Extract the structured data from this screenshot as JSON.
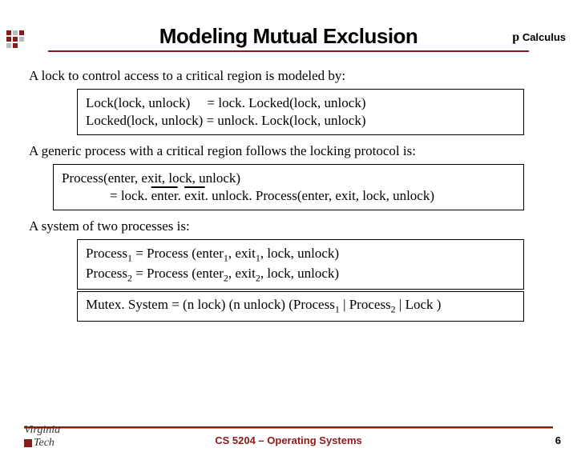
{
  "header": {
    "label": "Calculus",
    "pi": "p"
  },
  "title": "Modeling Mutual Exclusion",
  "p1": "A lock to control access to a critical region is modeled by:",
  "box1": {
    "l1": "Lock(lock, unlock)     = lock. Locked(lock, unlock)",
    "l2": "Locked(lock, unlock) = unlock. Lock(lock, unlock)"
  },
  "p2": "A generic process with a critical region follows the locking protocol is:",
  "box2": {
    "l1": "Process(enter, exit, lock, unlock)",
    "l2_pre": "= lock. ",
    "l2_enter": "enter",
    "l2_mid1": ". ",
    "l2_exit": "exit",
    "l2_mid2": ". unlock. Process(enter, exit, lock, unlock)"
  },
  "p3": "A system of two processes is:",
  "box3": {
    "l1a": "Process",
    "l1b": " = Process (enter",
    "l1c": ", exit",
    "l1d": ", lock, unlock)",
    "l2a": "Process",
    "l2b": " = Process (enter",
    "l2c": ", exit",
    "l2d": ", lock, unlock)"
  },
  "box4": {
    "pre": "Mutex. System = (",
    "nu": "n",
    "mid1": " lock) (",
    "mid2": " unlock) (Process",
    "mid3": " | Process",
    "mid4": " | Lock )"
  },
  "sub1": "1",
  "sub2": "2",
  "footer": {
    "center": "CS 5204 – Operating Systems",
    "page": "6",
    "vt1": "Virginia",
    "vt2": "Tech"
  }
}
